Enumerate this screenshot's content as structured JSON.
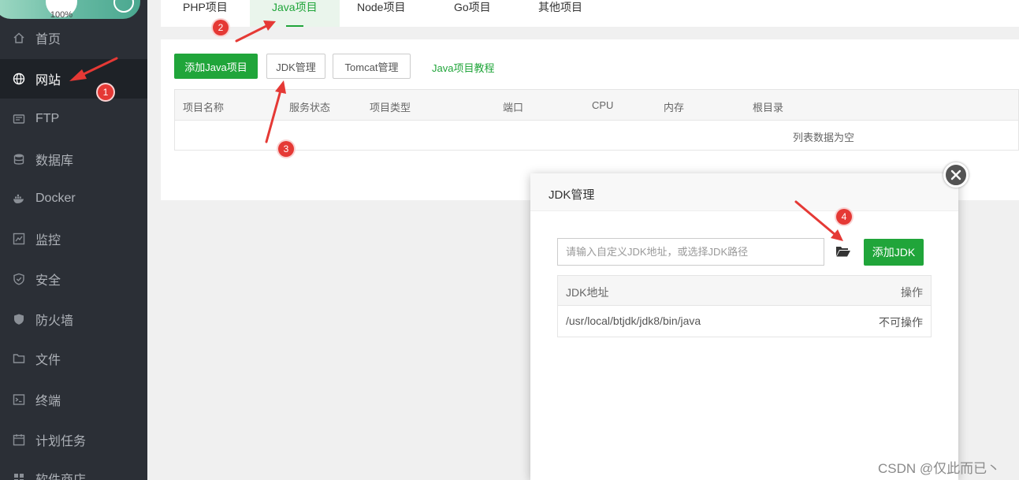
{
  "sidebar": {
    "ring_text": "100%",
    "items": [
      {
        "label": "首页",
        "icon": "home-icon"
      },
      {
        "label": "网站",
        "icon": "globe-icon",
        "active": true
      },
      {
        "label": "FTP",
        "icon": "ftp-icon"
      },
      {
        "label": "数据库",
        "icon": "database-icon"
      },
      {
        "label": "Docker",
        "icon": "docker-icon"
      },
      {
        "label": "监控",
        "icon": "monitor-icon"
      },
      {
        "label": "安全",
        "icon": "shield-check-icon"
      },
      {
        "label": "防火墙",
        "icon": "firewall-icon"
      },
      {
        "label": "文件",
        "icon": "folder-icon"
      },
      {
        "label": "终端",
        "icon": "terminal-icon"
      },
      {
        "label": "计划任务",
        "icon": "calendar-icon"
      },
      {
        "label": "软件商店",
        "icon": "store-icon"
      }
    ]
  },
  "tabs": [
    "PHP项目",
    "Java项目",
    "Node项目",
    "Go项目",
    "其他项目"
  ],
  "toolbar": {
    "add_java": "添加Java项目",
    "jdk_manage": "JDK管理",
    "tomcat_manage": "Tomcat管理",
    "tutorial": "Java项目教程"
  },
  "table": {
    "columns": [
      "项目名称",
      "服务状态",
      "项目类型",
      "端口",
      "CPU",
      "内存",
      "根目录"
    ],
    "empty_text": "列表数据为空"
  },
  "dialog": {
    "title": "JDK管理",
    "input_placeholder": "请输入自定义JDK地址，或选择JDK路径",
    "add_button": "添加JDK",
    "columns": {
      "address": "JDK地址",
      "action": "操作"
    },
    "rows": [
      {
        "address": "/usr/local/btjdk/jdk8/bin/java",
        "action": "不可操作"
      }
    ]
  },
  "annotations": [
    "1",
    "2",
    "3",
    "4"
  ],
  "watermark": "CSDN @仅此而已丶",
  "colors": {
    "accent": "#20a53a",
    "sidebar_bg": "#2b2f36",
    "badge": "#e53935"
  }
}
